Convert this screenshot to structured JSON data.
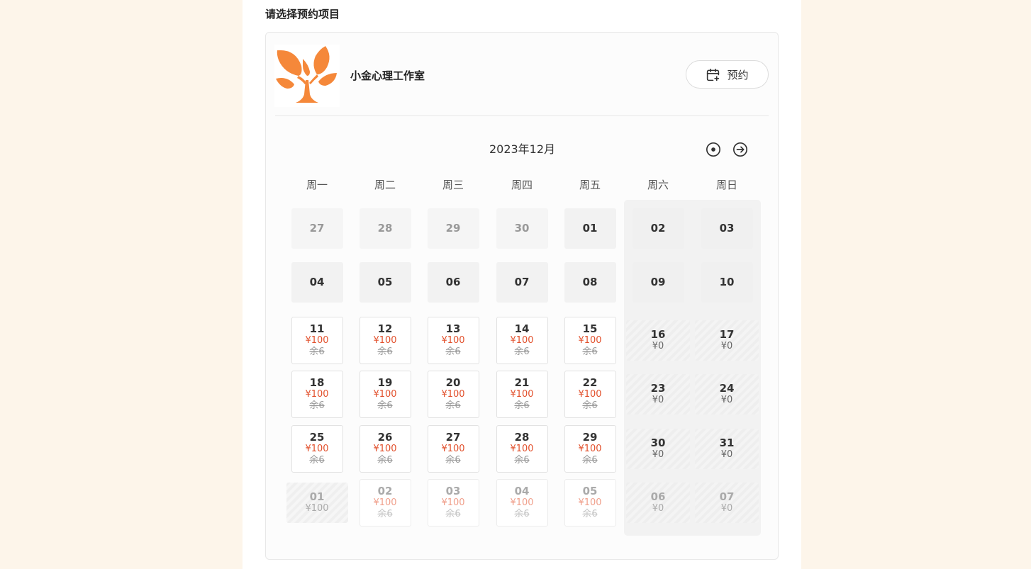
{
  "section_title": "请选择预约项目",
  "studio": {
    "name": "小金心理工作室",
    "logo_color": "#f5883a"
  },
  "book_button": {
    "label": "预约",
    "icon": "calendar-plus-icon"
  },
  "calendar": {
    "month_title": "2023年12月",
    "nav": {
      "today_icon": "target-icon",
      "next_icon": "arrow-right-circle-icon"
    },
    "weekdays": [
      "周一",
      "周二",
      "周三",
      "周四",
      "周五",
      "周六",
      "周日"
    ],
    "weeks": [
      [
        {
          "day": "27",
          "status": "other"
        },
        {
          "day": "28",
          "status": "other"
        },
        {
          "day": "29",
          "status": "other"
        },
        {
          "day": "30",
          "status": "other"
        },
        {
          "day": "01",
          "status": "plain"
        },
        {
          "day": "02",
          "status": "plainwk"
        },
        {
          "day": "03",
          "status": "plainwk"
        }
      ],
      [
        {
          "day": "04",
          "status": "plain"
        },
        {
          "day": "05",
          "status": "plain"
        },
        {
          "day": "06",
          "status": "plain"
        },
        {
          "day": "07",
          "status": "plain"
        },
        {
          "day": "08",
          "status": "plain"
        },
        {
          "day": "09",
          "status": "plainwk"
        },
        {
          "day": "10",
          "status": "plainwk"
        }
      ],
      [
        {
          "day": "11",
          "status": "avail",
          "price": "¥100",
          "remain": "余6"
        },
        {
          "day": "12",
          "status": "avail",
          "price": "¥100",
          "remain": "余6"
        },
        {
          "day": "13",
          "status": "avail",
          "price": "¥100",
          "remain": "余6"
        },
        {
          "day": "14",
          "status": "avail",
          "price": "¥100",
          "remain": "余6"
        },
        {
          "day": "15",
          "status": "avail",
          "price": "¥100",
          "remain": "余6"
        },
        {
          "day": "16",
          "status": "zero",
          "price": "¥0"
        },
        {
          "day": "17",
          "status": "zero",
          "price": "¥0"
        }
      ],
      [
        {
          "day": "18",
          "status": "avail",
          "price": "¥100",
          "remain": "余6"
        },
        {
          "day": "19",
          "status": "avail",
          "price": "¥100",
          "remain": "余6"
        },
        {
          "day": "20",
          "status": "avail",
          "price": "¥100",
          "remain": "余6"
        },
        {
          "day": "21",
          "status": "avail",
          "price": "¥100",
          "remain": "余6"
        },
        {
          "day": "22",
          "status": "avail",
          "price": "¥100",
          "remain": "余6"
        },
        {
          "day": "23",
          "status": "zero",
          "price": "¥0"
        },
        {
          "day": "24",
          "status": "zero",
          "price": "¥0"
        }
      ],
      [
        {
          "day": "25",
          "status": "avail",
          "price": "¥100",
          "remain": "余6"
        },
        {
          "day": "26",
          "status": "avail",
          "price": "¥100",
          "remain": "余6"
        },
        {
          "day": "27",
          "status": "avail",
          "price": "¥100",
          "remain": "余6"
        },
        {
          "day": "28",
          "status": "avail",
          "price": "¥100",
          "remain": "余6"
        },
        {
          "day": "29",
          "status": "avail",
          "price": "¥100",
          "remain": "余6"
        },
        {
          "day": "30",
          "status": "zero",
          "price": "¥0"
        },
        {
          "day": "31",
          "status": "zero",
          "price": "¥0"
        }
      ],
      [
        {
          "day": "01",
          "status": "nextfirst",
          "price": "¥100"
        },
        {
          "day": "02",
          "status": "nextavail",
          "price": "¥100",
          "remain": "余6"
        },
        {
          "day": "03",
          "status": "nextavail",
          "price": "¥100",
          "remain": "余6"
        },
        {
          "day": "04",
          "status": "nextavail",
          "price": "¥100",
          "remain": "余6"
        },
        {
          "day": "05",
          "status": "nextavail",
          "price": "¥100",
          "remain": "余6"
        },
        {
          "day": "06",
          "status": "nextzero",
          "price": "¥0"
        },
        {
          "day": "07",
          "status": "nextzero",
          "price": "¥0"
        }
      ]
    ]
  }
}
